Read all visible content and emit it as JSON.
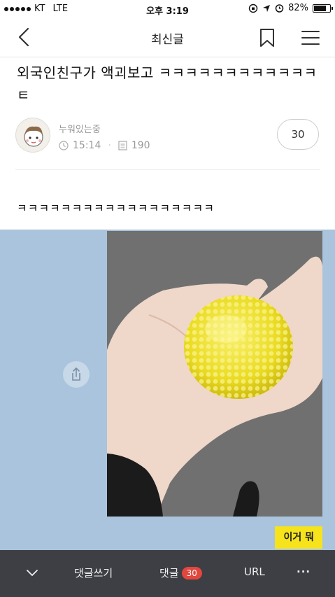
{
  "status_bar": {
    "carrier": "KT",
    "network": "LTE",
    "time": "오후 3:19",
    "battery": "82%"
  },
  "nav": {
    "title": "최신글"
  },
  "post": {
    "title": "외국인친구가 액괴보고 ㅋㅋㅋㅋㅋㅋㅋㅋㅋㅋㅋㅋㅌ",
    "author": "누워있는중",
    "time": "15:14",
    "views": "190",
    "comment_count": "30",
    "body": "ㅋㅋㅋㅋㅋㅋㅋㅋㅋㅋㅋㅋㅋㅋㅋㅋㅋㅋ",
    "image_caption": "이거 뭐"
  },
  "bottom_bar": {
    "write_comment": "댓글쓰기",
    "comments_label": "댓글",
    "comments_badge": "30",
    "url_label": "URL",
    "more_label": "···"
  },
  "colors": {
    "image_bg": "#a9c4dc",
    "caption_bg": "#f6e31c",
    "bottom_bar_bg": "#3e3f45",
    "badge": "#e2473e",
    "slime": "#f1e43a"
  }
}
